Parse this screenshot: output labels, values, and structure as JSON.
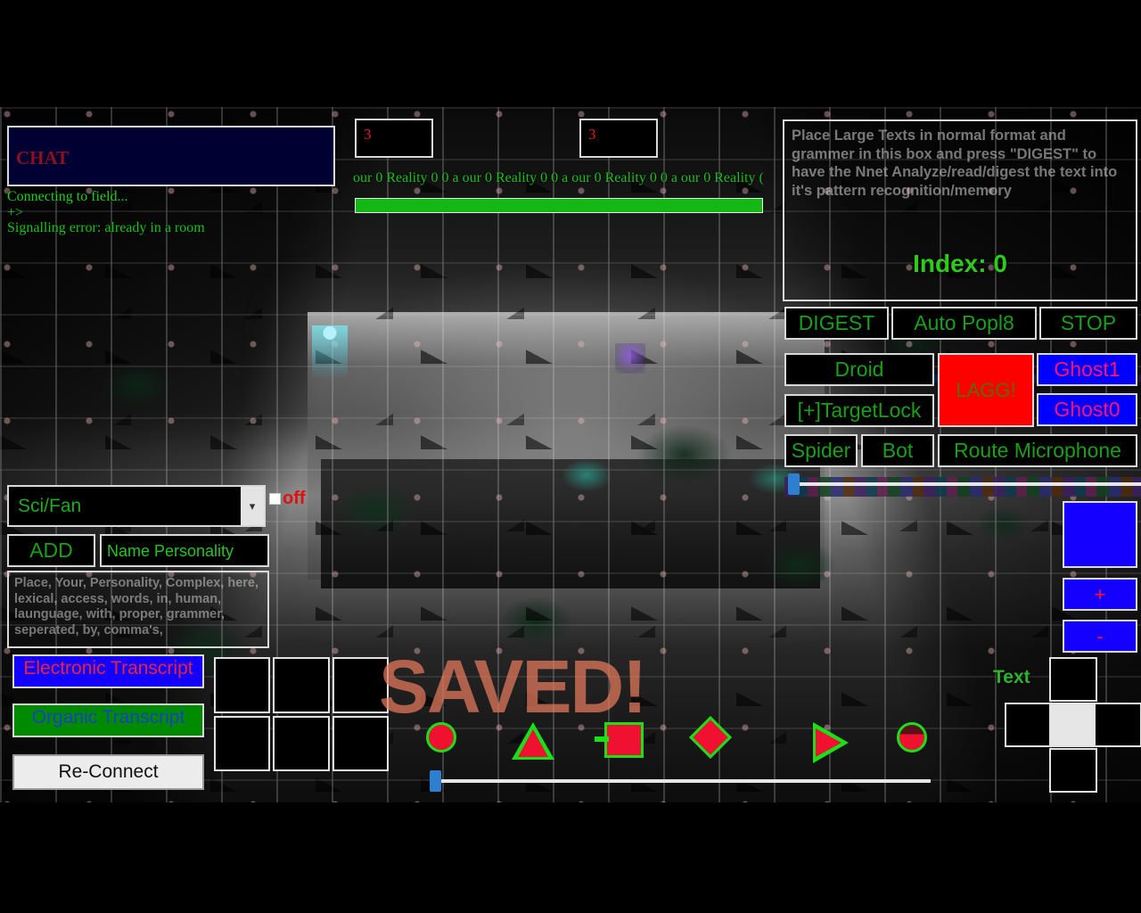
{
  "chat": {
    "placeholder": "CHAT",
    "log": [
      "Connecting to field...",
      "+>",
      "Signalling error: already in a room"
    ]
  },
  "top_inputs": {
    "left_value": "3",
    "right_value": "3"
  },
  "marquee": {
    "text": "our 0 Reality 0 0 a our 0 Reality 0 0 a our 0 Reality 0 0 a our 0 Reality ("
  },
  "progress": {
    "percent": 100
  },
  "digest": {
    "placeholder": "Place Large Texts in normal format and grammer in this box and press \"DIGEST\" to have the Nnet Analyze/read/digest the text into it's pattern recognition/memory",
    "index_label": "Index: 0"
  },
  "buttons": {
    "digest": "DIGEST",
    "auto_popl8": "Auto Popl8",
    "stop": "STOP",
    "droid": "Droid",
    "target_lock": "[+]TargetLock",
    "lagg": "LAGG!",
    "ghost1": "Ghost1",
    "ghost0": "Ghost0",
    "spider": "Spider",
    "bot": "Bot",
    "route_microphone": "Route Microphone",
    "add": "ADD",
    "electronic_transcript": "Electronic Transcript",
    "organic_transcript": "Organic Transcript",
    "reconnect": "Re-Connect",
    "plus": "+",
    "minus": "-"
  },
  "personality": {
    "genre_selected": "Sci/Fan",
    "genre_options": [
      "Sci/Fan"
    ],
    "name_placeholder": "Name Personality",
    "description_placeholder": "Place, Your, Personality, Complex, here, lexical, access, words, in, human, launguage, with, proper, grammer, seperated, by, comma's,"
  },
  "toggle": {
    "label": "off",
    "checked": false
  },
  "overlay": {
    "saved_text": "SAVED!"
  },
  "shapes": [
    {
      "name": "circle"
    },
    {
      "name": "triangle"
    },
    {
      "name": "square"
    },
    {
      "name": "diamond"
    },
    {
      "name": "play-triangle"
    },
    {
      "name": "half-circle"
    }
  ],
  "right_panel": {
    "text_label": "Text"
  },
  "colors": {
    "green_text": "#18a018",
    "red_alert": "#ff0000",
    "blue_button": "#1400ff",
    "chat_bg": "#000033",
    "pink_label": "#ff1474"
  }
}
